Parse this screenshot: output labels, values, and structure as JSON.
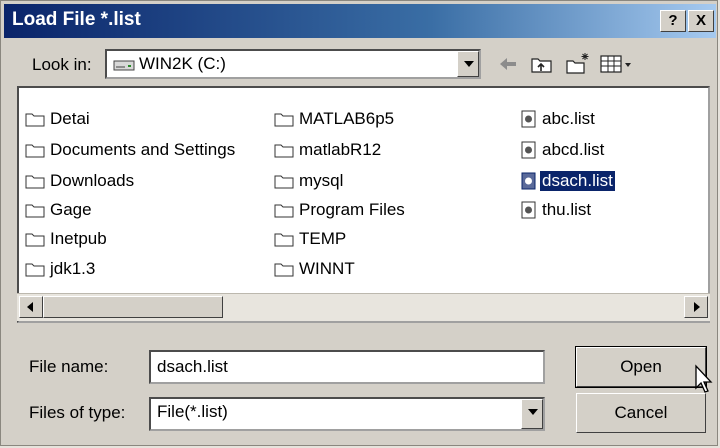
{
  "dialog": {
    "title": "Load File *.list",
    "help_button": "?",
    "close_button": "X"
  },
  "lookin": {
    "label": "Look in:",
    "value": "WIN2K (C:)"
  },
  "toolbar": {
    "icons": [
      "back-arrow-icon",
      "up-folder-icon",
      "new-folder-icon",
      "view-menu-icon"
    ]
  },
  "files": {
    "col1": [
      "Detai",
      "Documents and Settings",
      "Downloads",
      "Gage",
      "Inetpub",
      "jdk1.3"
    ],
    "col2": [
      "MATLAB6p5",
      "matlabR12",
      "mysql",
      "Program Files",
      "TEMP",
      "WINNT"
    ],
    "col3": [
      "abc.list",
      "abcd.list",
      "dsach.list",
      "thu.list"
    ],
    "selected": "dsach.list"
  },
  "filename": {
    "label": "File name:",
    "value": "dsach.list"
  },
  "filetype": {
    "label": "Files of type:",
    "value": "File(*.list)"
  },
  "buttons": {
    "open": "Open",
    "cancel": "Cancel"
  },
  "colors": {
    "title_start": "#0a246a",
    "title_end": "#a6caf0",
    "selection": "#0a246a",
    "face": "#d4d0c8"
  }
}
